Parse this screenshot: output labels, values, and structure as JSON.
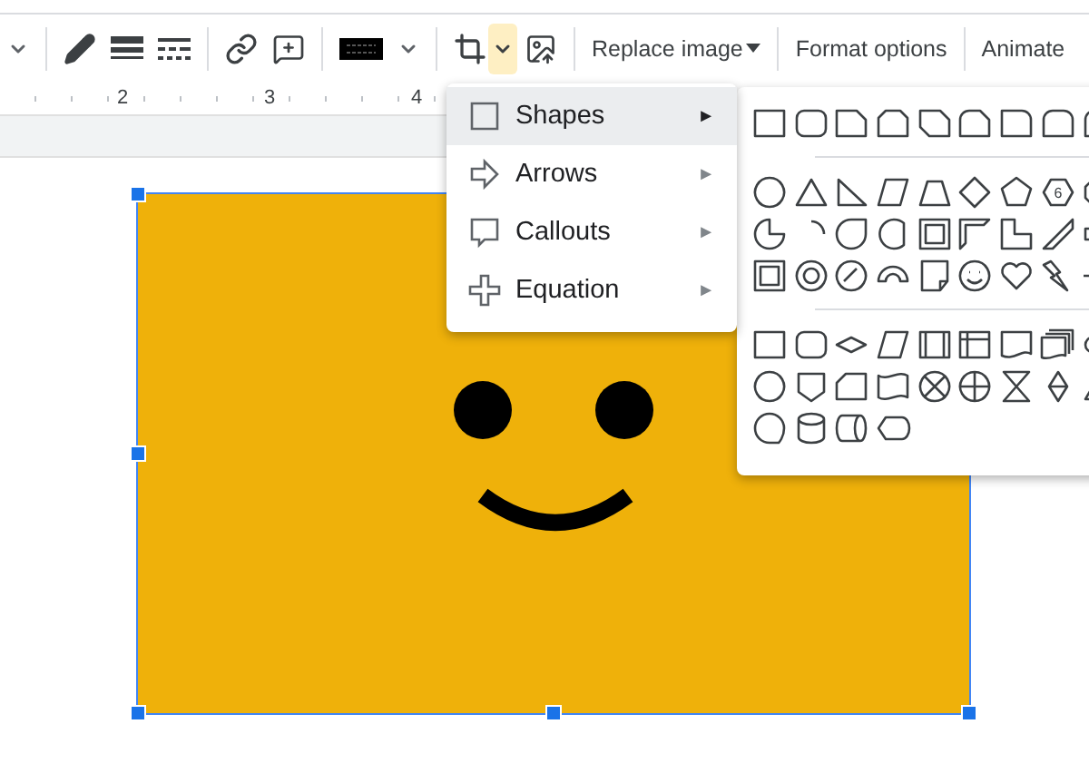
{
  "toolbar": {
    "buttons": [
      {
        "kind": "caret"
      },
      {
        "kind": "divider"
      },
      {
        "kind": "pencil"
      },
      {
        "kind": "weight"
      },
      {
        "kind": "dash"
      },
      {
        "kind": "divider"
      },
      {
        "kind": "link"
      },
      {
        "kind": "comment"
      },
      {
        "kind": "divider"
      },
      {
        "kind": "border-color",
        "color": "#000000"
      },
      {
        "kind": "caret"
      },
      {
        "kind": "divider"
      },
      {
        "kind": "crop"
      },
      {
        "kind": "crop-caret",
        "selected": true
      },
      {
        "kind": "reset-image"
      },
      {
        "kind": "divider"
      },
      {
        "kind": "text",
        "label": "Replace image",
        "dropdown": true
      },
      {
        "kind": "divider"
      },
      {
        "kind": "text",
        "label": "Format options",
        "dropdown": false
      },
      {
        "kind": "divider"
      },
      {
        "kind": "text",
        "label": "Animate",
        "dropdown": false
      }
    ]
  },
  "ruler": {
    "numbers": [
      "2",
      "3",
      "4"
    ]
  },
  "slide": {
    "image": {
      "kind": "smiley",
      "selected": true,
      "handles": [
        {
          "kind": "top-left"
        },
        {
          "kind": "left"
        },
        {
          "kind": "bottom-left"
        },
        {
          "kind": "bottom"
        },
        {
          "kind": "bottom-right"
        }
      ]
    }
  },
  "menu": {
    "items": [
      {
        "label": "Shapes",
        "kind": "square",
        "selected": true
      },
      {
        "label": "Arrows",
        "kind": "arrow",
        "selected": false
      },
      {
        "label": "Callouts",
        "kind": "callout",
        "selected": false
      },
      {
        "label": "Equation",
        "kind": "plus",
        "selected": false
      }
    ],
    "submenu_marker": "►"
  },
  "shapes_submenu": {
    "sections": [
      [
        [
          {
            "kind": "rect"
          },
          {
            "kind": "rounded"
          },
          {
            "kind": "snip"
          },
          {
            "kind": "snip2"
          },
          {
            "kind": "snipdiag"
          },
          {
            "kind": "roundsnip"
          },
          {
            "kind": "round1"
          },
          {
            "kind": "round2"
          },
          {
            "kind": "round2"
          }
        ]
      ],
      [
        [
          {
            "kind": "circle"
          },
          {
            "kind": "triangle"
          },
          {
            "kind": "rtriangle"
          },
          {
            "kind": "parallelogram"
          },
          {
            "kind": "trapezoid"
          },
          {
            "kind": "diamond"
          },
          {
            "kind": "pentagon"
          },
          {
            "kind": "hexagon",
            "label": "6"
          },
          {
            "kind": "octagon"
          }
        ],
        [
          {
            "kind": "pie"
          },
          {
            "kind": "arc"
          },
          {
            "kind": "teardrop"
          },
          {
            "kind": "chord"
          },
          {
            "kind": "frame"
          },
          {
            "kind": "halfframe"
          },
          {
            "kind": "lshape"
          },
          {
            "kind": "diagstripe"
          },
          {
            "kind": "plus"
          }
        ],
        [
          {
            "kind": "bevel"
          },
          {
            "kind": "donut"
          },
          {
            "kind": "nosymbol"
          },
          {
            "kind": "blockarc"
          },
          {
            "kind": "folded"
          },
          {
            "kind": "smiley"
          },
          {
            "kind": "heart"
          },
          {
            "kind": "lightning"
          },
          {
            "kind": "sun"
          }
        ]
      ],
      [
        [
          {
            "kind": "rect"
          },
          {
            "kind": "rounded"
          },
          {
            "kind": "decision"
          },
          {
            "kind": "parallelogram"
          },
          {
            "kind": "predefined"
          },
          {
            "kind": "internal"
          },
          {
            "kind": "document"
          },
          {
            "kind": "multidoc"
          },
          {
            "kind": "terminator"
          }
        ],
        [
          {
            "kind": "circle"
          },
          {
            "kind": "offpage"
          },
          {
            "kind": "card"
          },
          {
            "kind": "punched"
          },
          {
            "kind": "summing"
          },
          {
            "kind": "or"
          },
          {
            "kind": "collate"
          },
          {
            "kind": "sort"
          },
          {
            "kind": "triangle"
          }
        ],
        [
          {
            "kind": "seqstorage"
          },
          {
            "kind": "disk"
          },
          {
            "kind": "direct"
          },
          {
            "kind": "display"
          }
        ]
      ]
    ]
  }
}
